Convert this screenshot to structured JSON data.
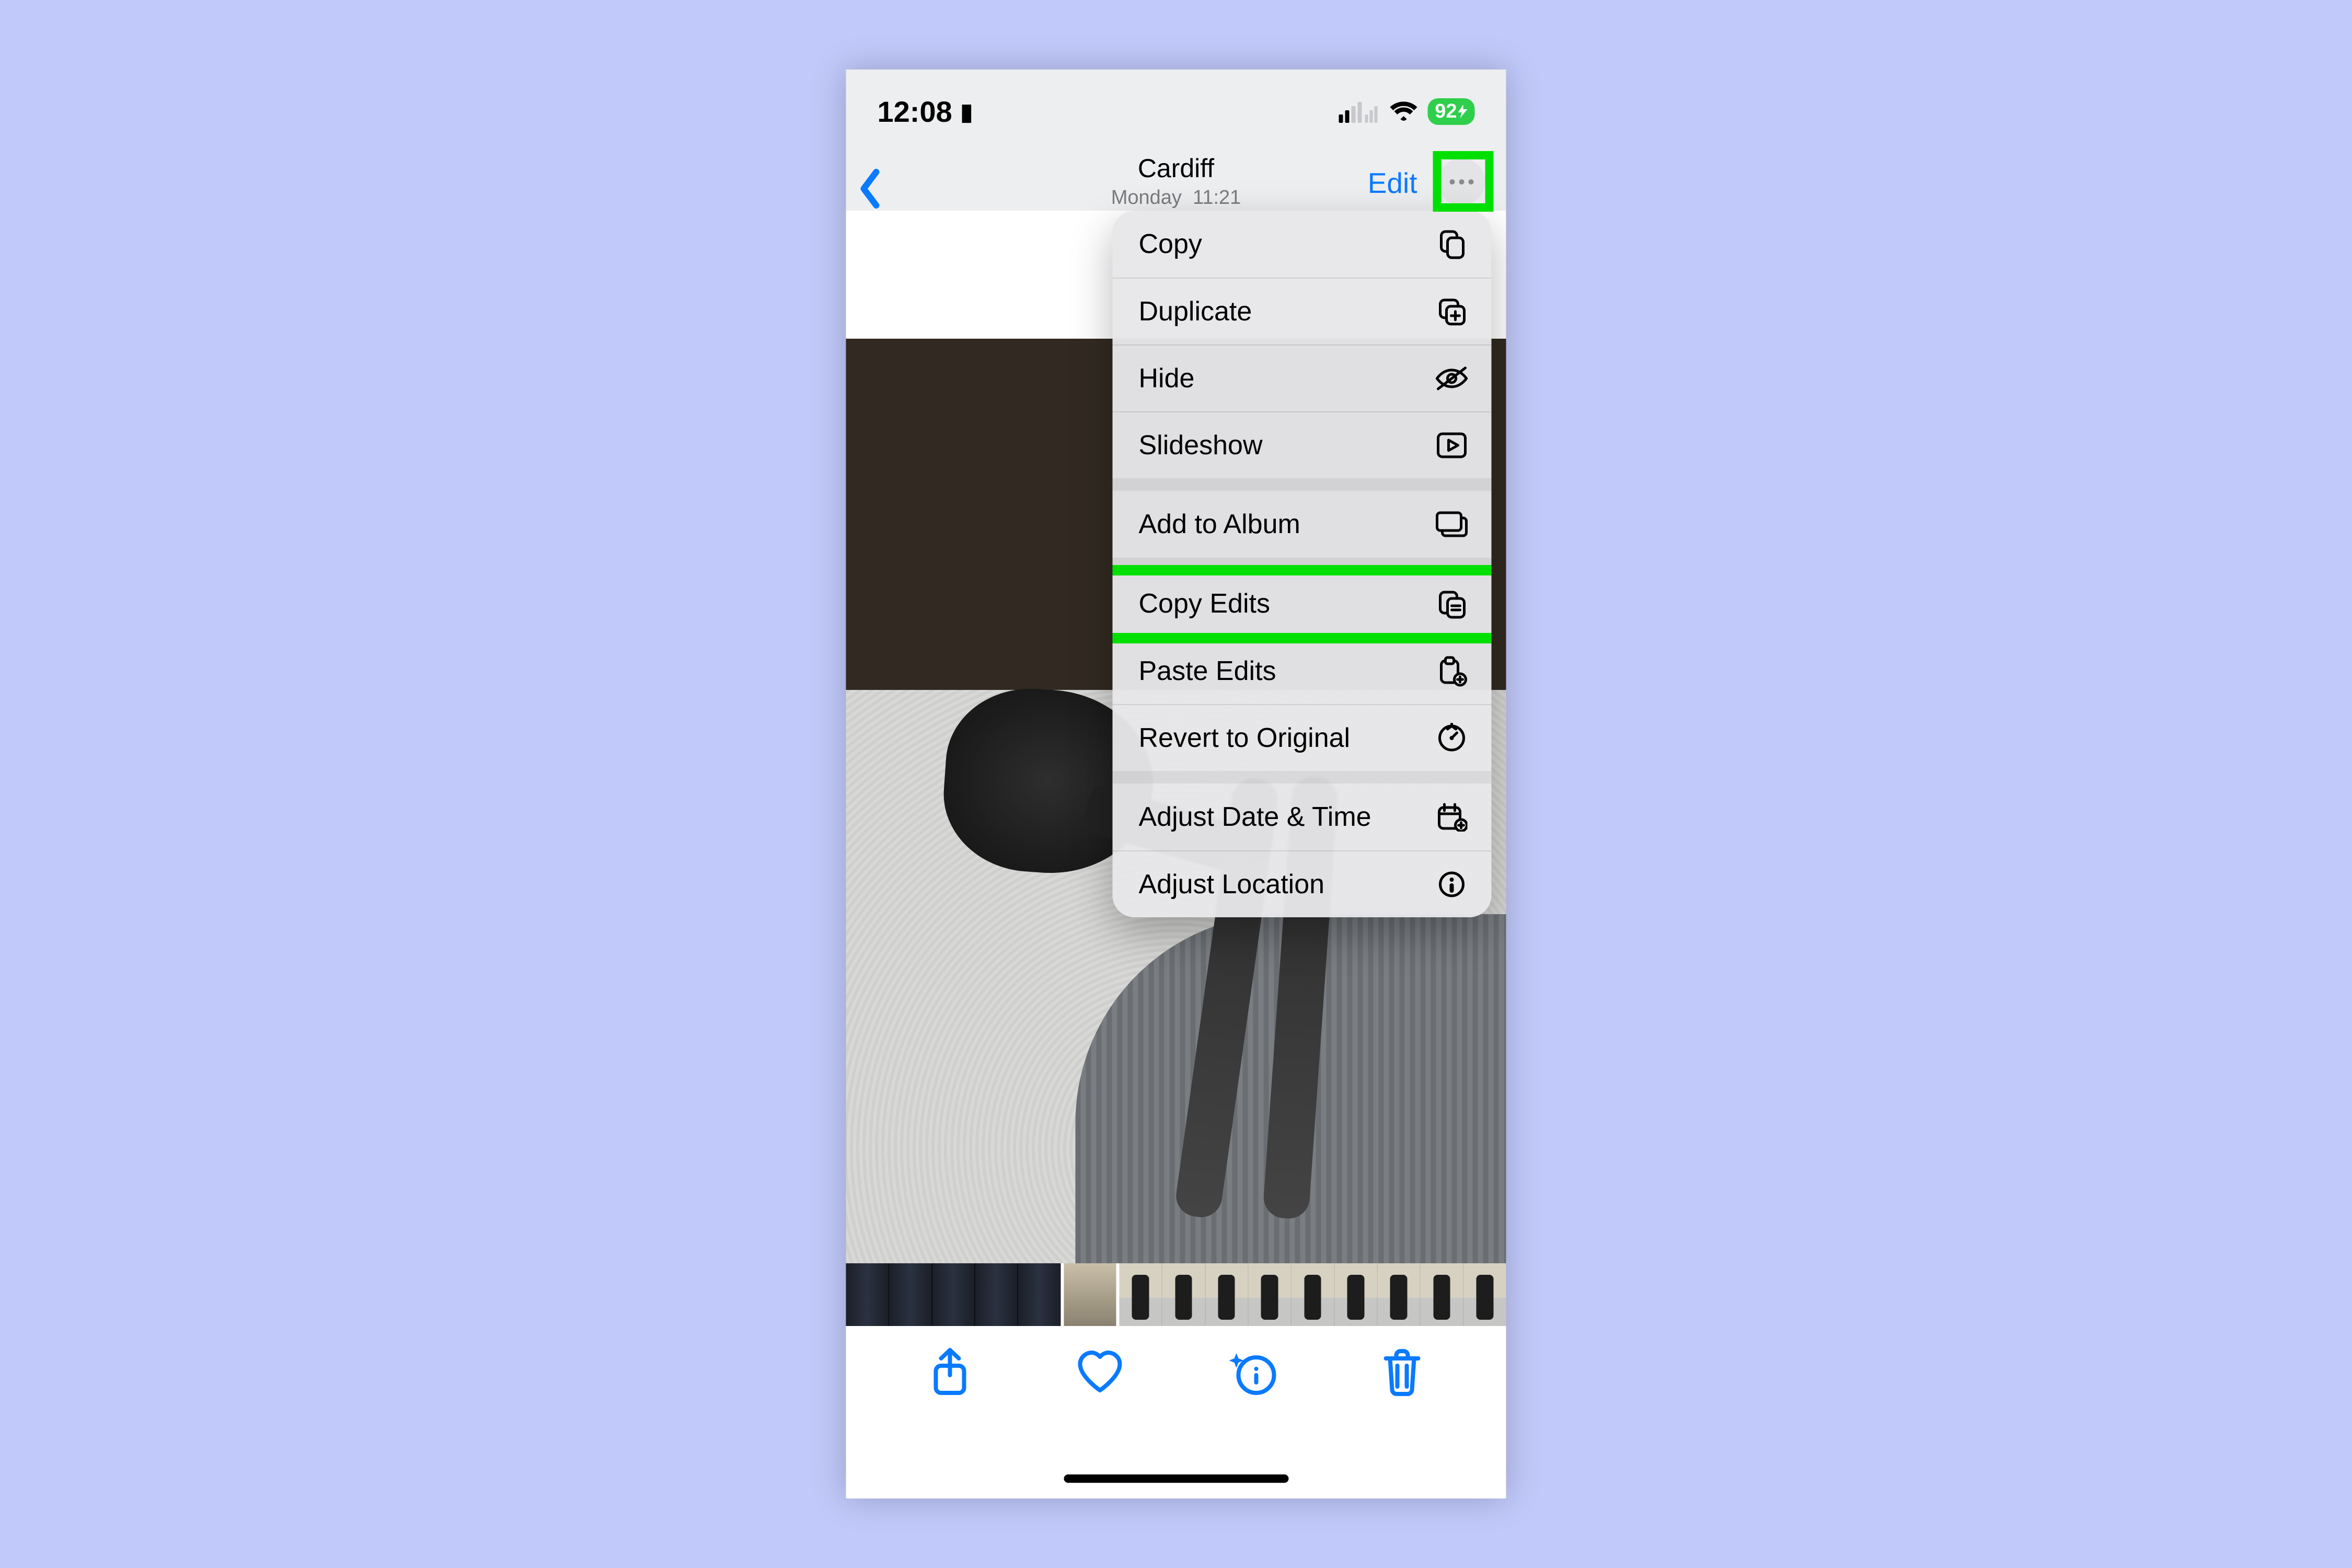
{
  "status": {
    "time": "12:08",
    "battery": "92"
  },
  "nav": {
    "title": "Cardiff",
    "subtitle_day": "Monday",
    "subtitle_time": "11:21",
    "edit_label": "Edit"
  },
  "menu": {
    "groups": [
      [
        "Copy",
        "Duplicate",
        "Hide",
        "Slideshow"
      ],
      [
        "Add to Album"
      ],
      [
        "Copy Edits",
        "Paste Edits",
        "Revert to Original"
      ],
      [
        "Adjust Date & Time",
        "Adjust Location"
      ]
    ],
    "highlighted_item": "Copy Edits"
  },
  "highlight": {
    "more_button": true,
    "menu_item": "Copy Edits"
  },
  "colors": {
    "page_bg": "#c1c9fa",
    "ios_blue": "#0a7aff",
    "highlight": "#00e000",
    "battery_green": "#2fcf4b"
  }
}
